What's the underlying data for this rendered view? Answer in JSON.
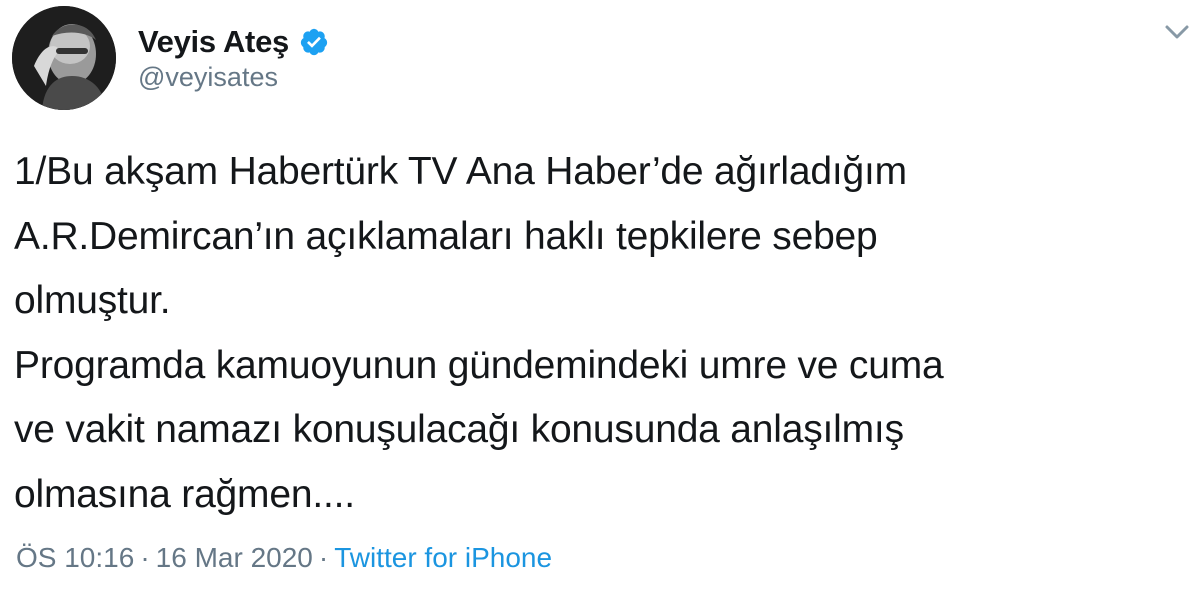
{
  "author": {
    "display_name": "Veyis Ateş",
    "handle": "@veyisates",
    "verified": true,
    "avatar_icon": "profile-photo-avatar"
  },
  "menu": {
    "icon": "chevron-down-icon"
  },
  "tweet": {
    "lines": [
      "1/Bu akşam Habertürk TV Ana Haber’de ağırladığım",
      "A.R.Demircan’ın açıklamaları haklı tepkilere sebep",
      "olmuştur.",
      "Programda kamuoyunun gündemindeki umre ve cuma",
      "ve vakit namazı konuşulacağı konusunda anlaşılmış",
      "olmasına rağmen...."
    ]
  },
  "meta": {
    "time": "ÖS 10:16",
    "separator": "·",
    "date": "16 Mar 2020",
    "source": "Twitter for iPhone"
  },
  "colors": {
    "text": "#14171a",
    "secondary": "#657786",
    "accent": "#1b95e0",
    "verified": "#1da1f2"
  }
}
